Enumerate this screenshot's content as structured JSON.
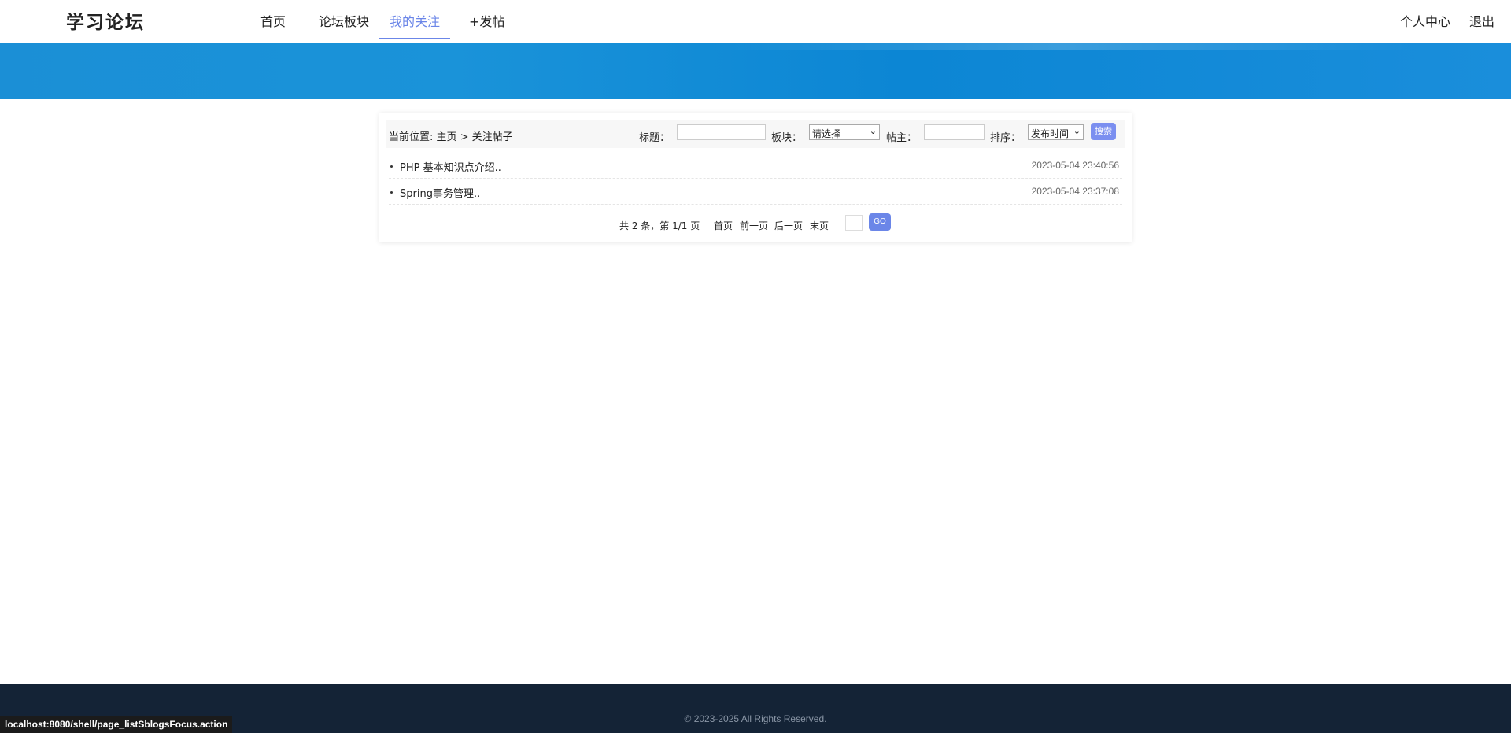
{
  "header": {
    "logo": "学习论坛",
    "nav": [
      {
        "label": "首页"
      },
      {
        "label": "论坛板块"
      },
      {
        "label": "我的关注"
      },
      {
        "label": "+发帖"
      }
    ],
    "user_center": "个人中心",
    "logout": "退出"
  },
  "search": {
    "breadcrumb": "当前位置: 主页 > 关注帖子",
    "title_label": "标题：",
    "title_value": "",
    "board_label": "板块：",
    "board_selected": "请选择",
    "author_label": "帖主：",
    "author_value": "",
    "sort_label": "排序：",
    "sort_selected": "发布时间",
    "search_button": "搜索"
  },
  "posts": [
    {
      "title": "PHP 基本知识点介绍..",
      "time": "2023-05-04 23:40:56"
    },
    {
      "title": "Spring事务管理..",
      "time": "2023-05-04 23:37:08"
    }
  ],
  "pager": {
    "summary": "共 2 条，第 1/1 页",
    "first": "首页",
    "prev": "前一页",
    "next": "后一页",
    "last": "末页",
    "go": "GO"
  },
  "footer": {
    "copyright": "© 2023-2025 All Rights Reserved."
  },
  "status_bar": "localhost:8080/shell/page_listSblogsFocus.action",
  "colors": {
    "accent": "#6b86e8",
    "banner": "#1a8fd8",
    "footer": "#142336"
  }
}
